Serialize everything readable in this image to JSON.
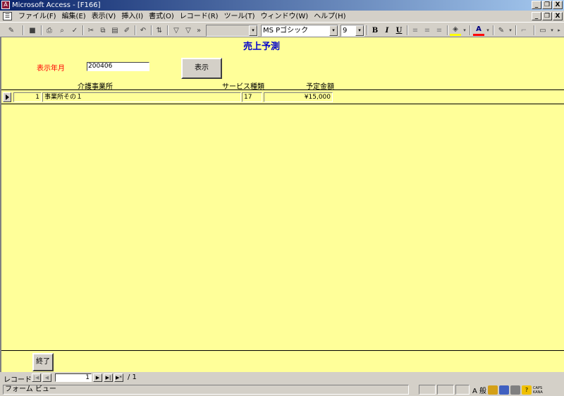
{
  "window": {
    "title": "Microsoft Access - [F166]",
    "app_icon_glyph": "A",
    "controls": [
      "_",
      "❐",
      "X"
    ]
  },
  "menubar": {
    "icon_glyph": "☰",
    "items": [
      "ファイル(F)",
      "編集(E)",
      "表示(V)",
      "挿入(I)",
      "書式(O)",
      "レコード(R)",
      "ツール(T)",
      "ウィンドウ(W)",
      "ヘルプ(H)"
    ],
    "controls": [
      "_",
      "❐",
      "X"
    ]
  },
  "toolbar": {
    "view_icon": "✎",
    "save_icon": "■",
    "print_icon": "⎙",
    "preview_icon": "⌕",
    "spell_icon": "✓",
    "cut_icon": "✂",
    "copy_icon": "⧉",
    "paste_icon": "▤",
    "format_painter_icon": "✐",
    "undo_icon": "↶",
    "sort_icon": "⇅",
    "filter_selection_icon": "▽",
    "filter_form_icon": "▽",
    "more_icon": "»",
    "object_combo": "",
    "font_name": "MS Pゴシック",
    "font_size": "9",
    "bold": "B",
    "italic": "I",
    "underline": "U",
    "align_left_icon": "≡",
    "align_center_icon": "≡",
    "align_right_icon": "≡",
    "fill_color_icon": "◈",
    "font_color_label": "A",
    "line_color_icon": "✎",
    "border_style_icon": "⌐",
    "line_width_icon": "▭",
    "dropdown_glyph": "▾",
    "overflow_glyph": "▸",
    "fill_color": "#ffff00",
    "font_color": "#ff0000"
  },
  "form": {
    "title": "売上予測",
    "year_label": "表示年月",
    "year_value": "200406",
    "show_button": "表示",
    "columns": {
      "office": "介護事業所",
      "service_type": "サービス種類",
      "amount": "予定金額"
    },
    "rows": [
      {
        "no": "1",
        "office": "事業所その１",
        "service_type": "17",
        "amount": "¥15,000"
      }
    ],
    "end_button": "終了"
  },
  "navigation": {
    "label": "レコード:",
    "current": "1",
    "total": "/ 1",
    "first": "|◀",
    "prev": "◀",
    "next": "▶",
    "last": "▶|",
    "new": "▶*"
  },
  "status": {
    "text": "フォーム ビュー",
    "ime_mode": "A 般",
    "ime_caps": "CAPS",
    "ime_kana": "KANA"
  },
  "colors": {
    "form_background": "#ffff99",
    "title_color": "#0000cc",
    "year_label_color": "#ff0000",
    "titlebar_start": "#0a246a",
    "titlebar_end": "#a6caf0"
  }
}
